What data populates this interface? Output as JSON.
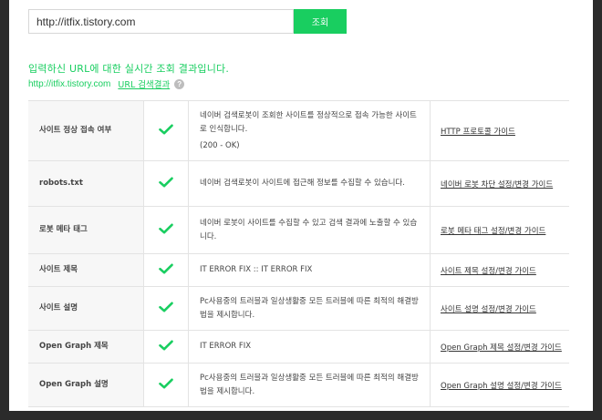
{
  "search": {
    "value": "http://itfix.tistory.com",
    "button_label": "조회"
  },
  "result": {
    "heading": "입력하신 URL에 대한 실시간 조회 결과입니다.",
    "url": "http://itfix.tistory.com",
    "link_label": "URL 검색결과",
    "help_symbol": "?"
  },
  "accent_color": "#19ce60",
  "rows": [
    {
      "label": "사이트 정상 접속 여부",
      "status": "check-icon",
      "description": "네이버 검색로봇이 조회한 사이트를 정상적으로 접속 가능한 사이트로 인식합니다.",
      "sub": "(200 - OK)",
      "guide": "HTTP 프로토콜 가이드"
    },
    {
      "label": "robots.txt",
      "status": "check-icon",
      "description": "네이버 검색로봇이 사이트에 접근해 정보를 수집할 수 있습니다.",
      "sub": "",
      "guide": "네이버 로봇 차단 설정/변경 가이드"
    },
    {
      "label": "로봇 메타 태그",
      "status": "check-icon",
      "description": "네이버 로봇이 사이트를 수집할 수 있고 검색 결과에 노출할 수 있습니다.",
      "sub": "",
      "guide": "로봇 메타 태그 설정/변경 가이드"
    },
    {
      "label": "사이트 제목",
      "status": "check-icon",
      "description": "IT ERROR FIX :: IT ERROR FIX",
      "sub": "",
      "guide": "사이트 제목 설정/변경 가이드"
    },
    {
      "label": "사이트 설명",
      "status": "check-icon",
      "description": "Pc사용중의 트러블과 일상생활중 모든 트러블에 따른 최적의 해결방법을 제시합니다.",
      "sub": "",
      "guide": "사이트 설명 설정/변경 가이드"
    },
    {
      "label": "Open Graph 제목",
      "status": "check-icon",
      "description": "IT ERROR FIX",
      "sub": "",
      "guide": "Open Graph 제목 설정/변경 가이드"
    },
    {
      "label": "Open Graph 설명",
      "status": "check-icon",
      "description": "Pc사용중의 트러블과 일상생활중 모든 트러블에 따른 최적의 해결방법을 제시합니다.",
      "sub": "",
      "guide": "Open Graph 설명 설정/변경 가이드"
    }
  ]
}
